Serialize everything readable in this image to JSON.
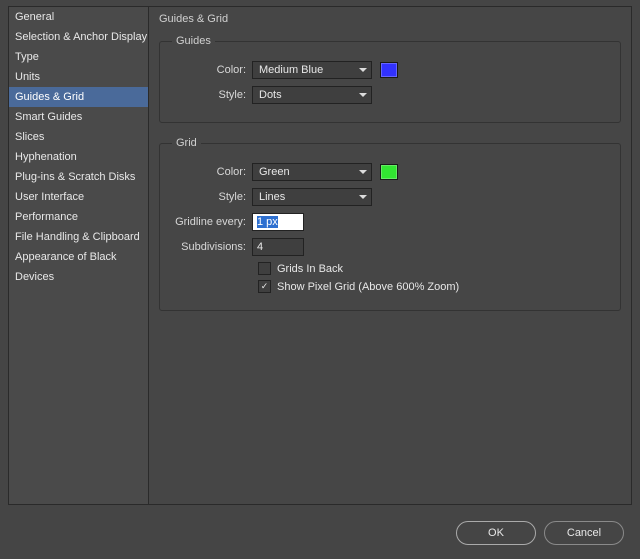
{
  "page_title": "Guides & Grid",
  "sidebar": {
    "items": [
      "General",
      "Selection & Anchor Display",
      "Type",
      "Units",
      "Guides & Grid",
      "Smart Guides",
      "Slices",
      "Hyphenation",
      "Plug-ins & Scratch Disks",
      "User Interface",
      "Performance",
      "File Handling & Clipboard",
      "Appearance of Black",
      "Devices"
    ],
    "selected_index": 4
  },
  "guides": {
    "legend": "Guides",
    "color_label": "Color:",
    "color_value": "Medium Blue",
    "color_swatch": "#3232ff",
    "style_label": "Style:",
    "style_value": "Dots"
  },
  "grid": {
    "legend": "Grid",
    "color_label": "Color:",
    "color_value": "Green",
    "color_swatch": "#32e632",
    "style_label": "Style:",
    "style_value": "Lines",
    "gridline_label": "Gridline every:",
    "gridline_value": "1 px",
    "subdivisions_label": "Subdivisions:",
    "subdivisions_value": "4",
    "grids_in_back_label": "Grids In Back",
    "grids_in_back_checked": false,
    "show_pixel_grid_label": "Show Pixel Grid (Above 600% Zoom)",
    "show_pixel_grid_checked": true
  },
  "buttons": {
    "ok": "OK",
    "cancel": "Cancel"
  }
}
